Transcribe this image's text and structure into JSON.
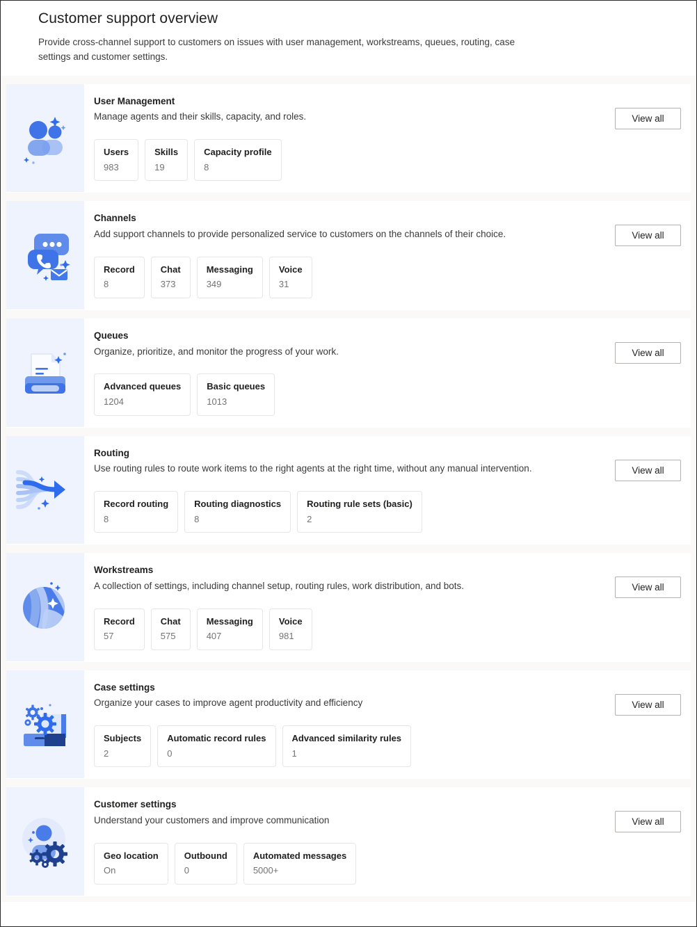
{
  "header": {
    "title": "Customer support overview",
    "subtitle": "Provide cross-channel support to customers on issues with user management, workstreams, queues, routing, case settings and customer settings."
  },
  "colors": {
    "icon_panel_bg": "#eff3fd",
    "page_bg": "#faf9f8",
    "card_bg": "#ffffff",
    "accent_blue": "#2f6ced",
    "accent_blue_light": "#a9c2f5",
    "text_primary": "#201f1e",
    "text_secondary": "#3b3a39",
    "stat_value": "#737373",
    "button_border": "#b3b0ad"
  },
  "cards": [
    {
      "icon": "people-icon",
      "title": "User Management",
      "description": "Manage agents and their skills, capacity, and roles.",
      "view_all_label": "View all",
      "stats": [
        {
          "label": "Users",
          "value": "983"
        },
        {
          "label": "Skills",
          "value": "19"
        },
        {
          "label": "Capacity profile",
          "value": "8"
        }
      ]
    },
    {
      "icon": "chat-phone-mail-icon",
      "title": "Channels",
      "description": "Add support channels to provide personalized service to customers on the channels of their choice.",
      "view_all_label": "View all",
      "stats": [
        {
          "label": "Record",
          "value": "8"
        },
        {
          "label": "Chat",
          "value": "373"
        },
        {
          "label": "Messaging",
          "value": "349"
        },
        {
          "label": "Voice",
          "value": "31"
        }
      ]
    },
    {
      "icon": "printer-document-icon",
      "title": "Queues",
      "description": "Organize, prioritize, and monitor the progress of your work.",
      "view_all_label": "View all",
      "stats": [
        {
          "label": "Advanced queues",
          "value": "1204"
        },
        {
          "label": "Basic queues",
          "value": "1013"
        }
      ]
    },
    {
      "icon": "routing-arrow-icon",
      "title": "Routing",
      "description": "Use routing rules to route work items to the right agents at the right time, without any manual intervention.",
      "view_all_label": "View all",
      "stats": [
        {
          "label": "Record routing",
          "value": "8"
        },
        {
          "label": "Routing diagnostics",
          "value": "8"
        },
        {
          "label": "Routing rule sets (basic)",
          "value": "2"
        }
      ]
    },
    {
      "icon": "sphere-streams-icon",
      "title": "Workstreams",
      "description": "A collection of settings, including channel setup, routing rules, work distribution, and bots.",
      "view_all_label": "View all",
      "stats": [
        {
          "label": "Record",
          "value": "57"
        },
        {
          "label": "Chat",
          "value": "575"
        },
        {
          "label": "Messaging",
          "value": "407"
        },
        {
          "label": "Voice",
          "value": "981"
        }
      ]
    },
    {
      "icon": "briefcase-gears-icon",
      "title": "Case settings",
      "description": "Organize your cases to improve agent productivity and efficiency",
      "view_all_label": "View all",
      "stats": [
        {
          "label": "Subjects",
          "value": "2"
        },
        {
          "label": "Automatic record rules",
          "value": "0"
        },
        {
          "label": "Advanced similarity rules",
          "value": "1"
        }
      ]
    },
    {
      "icon": "person-gears-icon",
      "title": "Customer settings",
      "description": "Understand your customers and improve communication",
      "view_all_label": "View all",
      "stats": [
        {
          "label": "Geo location",
          "value": "On"
        },
        {
          "label": "Outbound",
          "value": "0"
        },
        {
          "label": "Automated messages",
          "value": "5000+"
        }
      ]
    }
  ]
}
